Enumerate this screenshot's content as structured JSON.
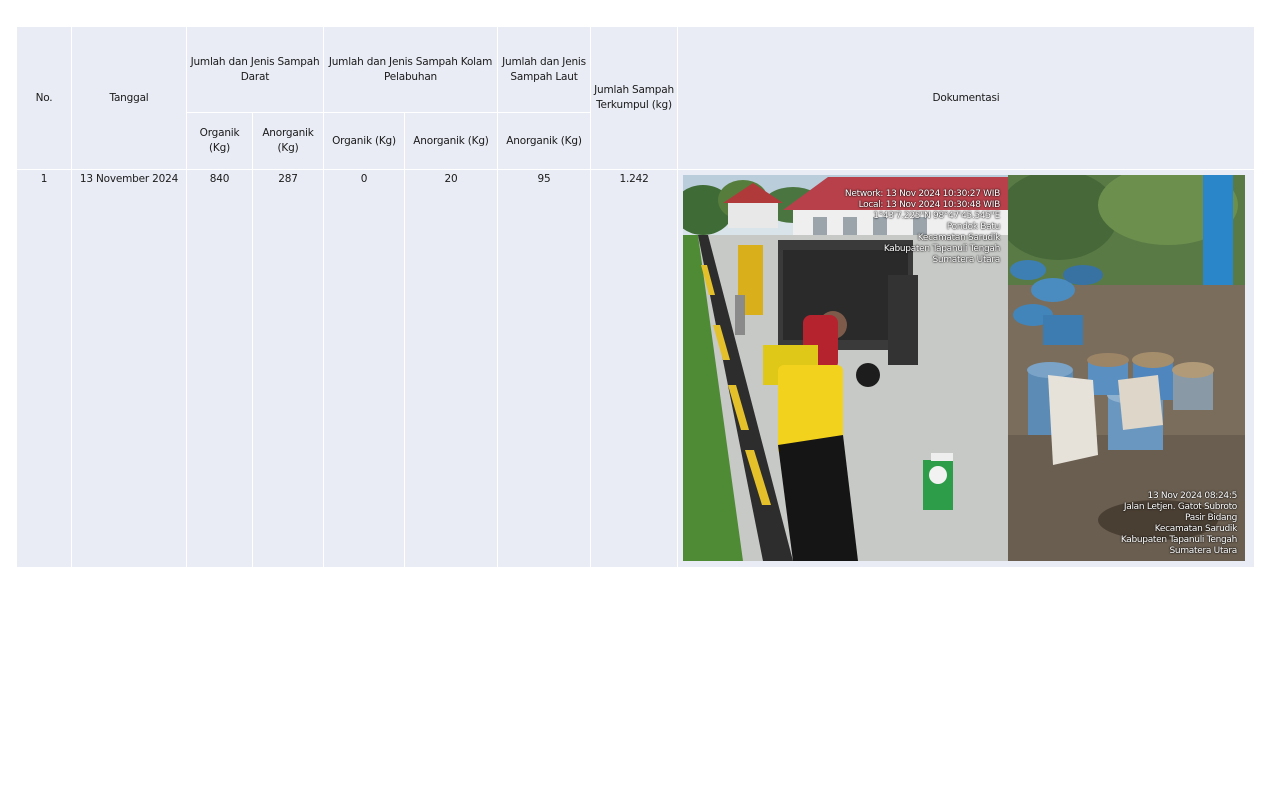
{
  "table": {
    "headers": {
      "no": "No.",
      "tanggal": "Tanggal",
      "darat": "Jumlah dan Jenis Sampah Darat",
      "kolam": "Jumlah dan Jenis Sampah Kolam Pelabuhan",
      "laut": "Jumlah dan Jenis Sampah Laut",
      "total": "Jumlah Sampah Terkumpul (kg)",
      "dokumentasi": "Dokumentasi",
      "organik": "Organik (Kg)",
      "anorganik": "Anorganik (Kg)"
    },
    "rows": [
      {
        "no": "1",
        "tanggal": "13 November 2024",
        "darat_organik": "840",
        "darat_anorganik": "287",
        "kolam_organik": "0",
        "kolam_anorganik": "20",
        "laut_anorganik": "95",
        "total": "1.242"
      }
    ]
  },
  "photos": {
    "left_stamp": [
      "Network: 13 Nov 2024 10:30:27 WIB",
      "Local: 13 Nov 2024 10:30:48 WIB",
      "1°43'7.225\"N 98°47'45.545\"E",
      "Pondok Batu",
      "Kecamatan Sarudik",
      "Kabupaten Tapanuli Tengah",
      "Sumatera Utara"
    ],
    "right_stamp": [
      "13 Nov 2024 08:24:5",
      "Jalan Letjen. Gatot Subroto",
      "Pasir Bidang",
      "Kecamatan Sarudik",
      "Kabupaten Tapanuli Tengah",
      "Sumatera Utara"
    ]
  }
}
